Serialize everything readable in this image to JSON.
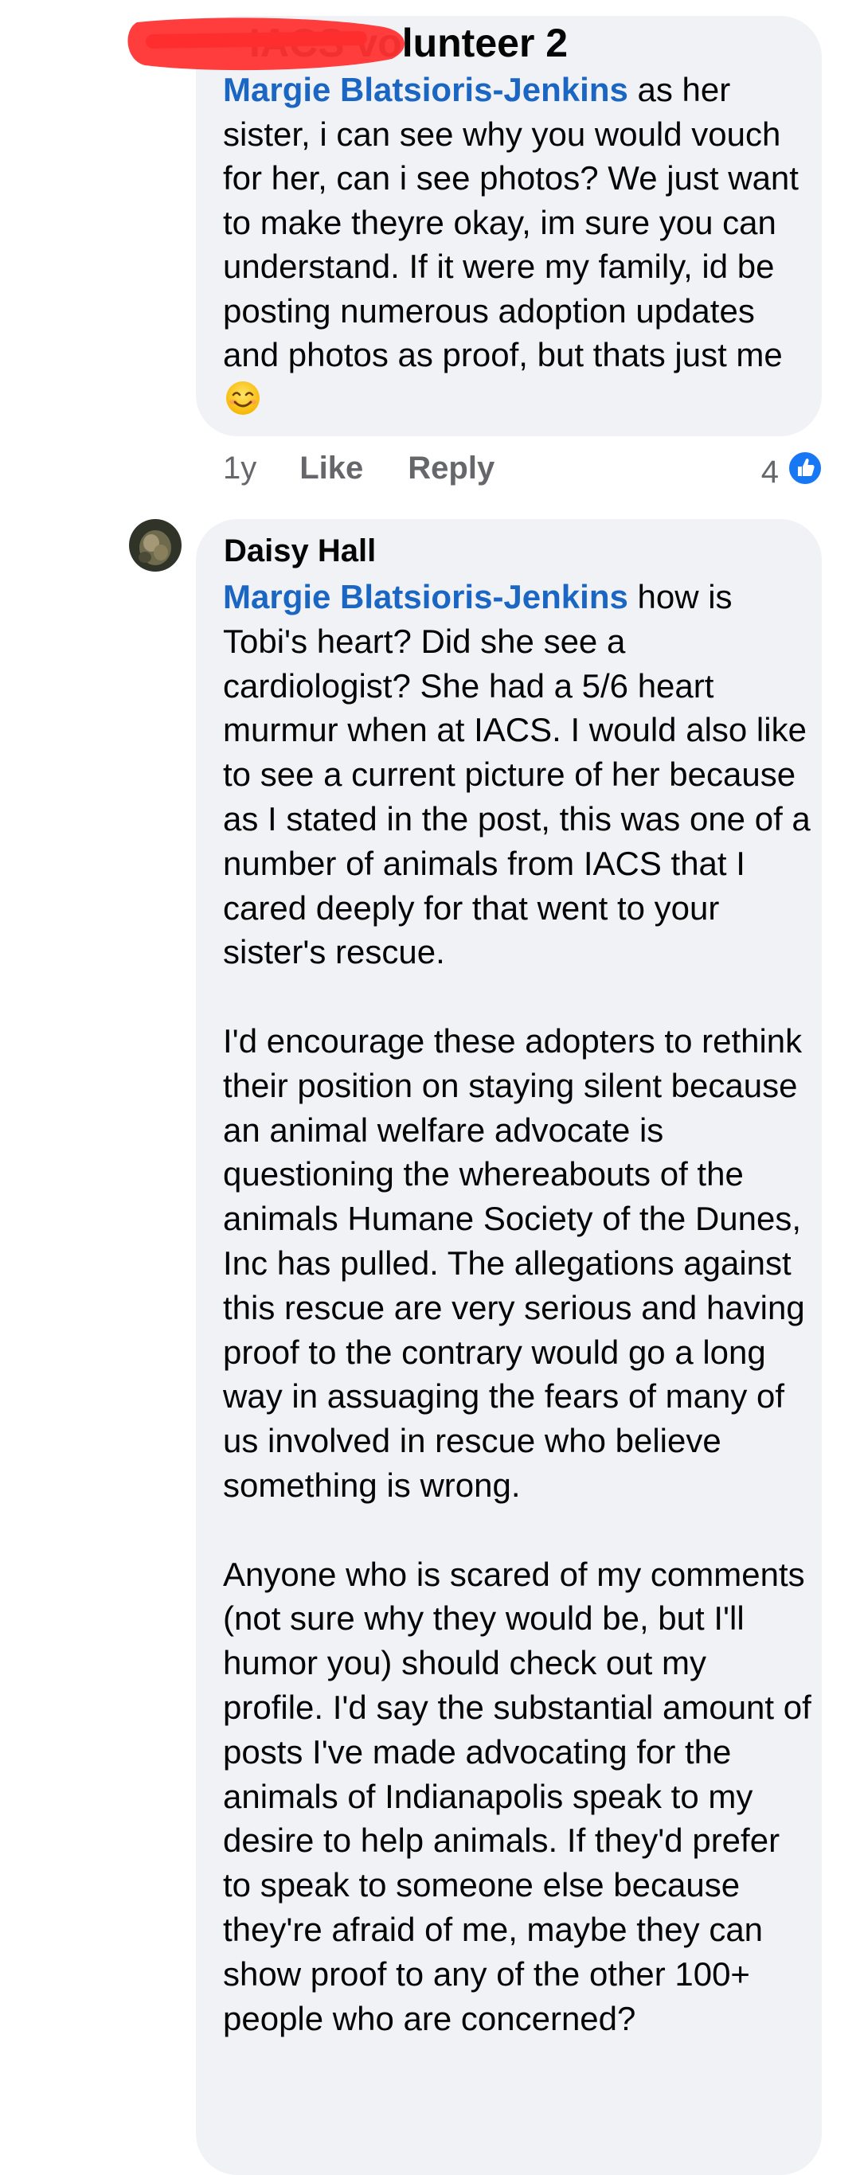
{
  "comments": [
    {
      "author": "IACS volunteer 2",
      "mention": "Margie Blatsioris-Jenkins",
      "text": " as her sister, i can see why you would vouch for her, can i see photos? We just want to make theyre okay, im sure you can understand. If it were my family, id be posting numerous adoption updates and photos as proof, but thats just me",
      "emoji": "smiling-face-emoji",
      "time": "1y",
      "like_label": "Like",
      "reply_label": "Reply",
      "reaction_count": "4",
      "reaction_icon": "like-reaction-icon",
      "redaction_color": "#ff3333"
    },
    {
      "author": "Daisy Hall",
      "avatar_icon": "profile-avatar",
      "mention": "Margie Blatsioris-Jenkins",
      "paragraphs": [
        " how is Tobi's heart? Did she see a cardiologist? She had a 5/6 heart murmur when at IACS. I would also like to see a current picture of her because as I stated in the post, this was one of a number of animals from IACS that I cared deeply for that went to your sister's rescue.",
        "I'd encourage these adopters to rethink their position on staying silent because an animal welfare advocate is questioning the whereabouts of the animals Humane Society of the Dunes, Inc has pulled. The allegations against this rescue are very serious and having proof to the contrary would go a long way in assuaging the fears of many of us involved in rescue who believe something is wrong.",
        "Anyone who is scared of my comments (not sure why they would be, but I'll humor you) should check out my profile. I'd say the substantial amount of posts I've made advocating for the animals of Indianapolis speak to my desire to help animals. If they'd prefer to speak to someone else because they're afraid of me, maybe they can show proof to any of the other 100+ people who are concerned?"
      ]
    }
  ],
  "colors": {
    "bubble": "#f0f2f5",
    "mention": "#1a66c2",
    "meta_text": "#65676b",
    "like_blue": "#1877f2"
  }
}
